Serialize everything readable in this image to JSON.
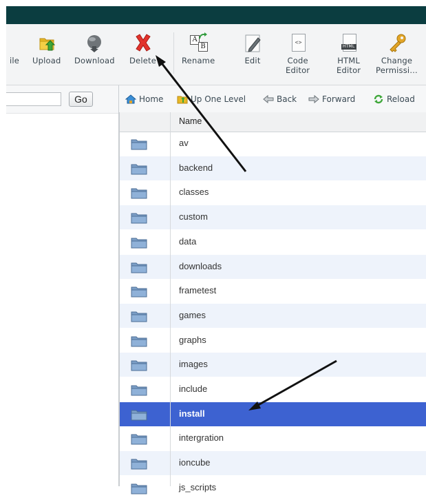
{
  "toolbar": {
    "file_partial": "ile",
    "upload": "Upload",
    "download": "Download",
    "delete": "Delete",
    "rename": "Rename",
    "edit": "Edit",
    "code_editor_1": "Code",
    "code_editor_2": "Editor",
    "html_editor_1": "HTML",
    "html_editor_2": "Editor",
    "change_perm_1": "Change",
    "change_perm_2": "Permissi…",
    "html_icon_text": "HTML",
    "rename_icon_a": "A",
    "rename_icon_b": "B",
    "code_icon_text": "<>"
  },
  "search": {
    "value": "",
    "go_label": "Go"
  },
  "nav": {
    "home": "Home",
    "up": "Up One Level",
    "back": "Back",
    "forward": "Forward",
    "reload": "Reload"
  },
  "table": {
    "header_name": "Name",
    "rows": [
      "av",
      "backend",
      "classes",
      "custom",
      "data",
      "downloads",
      "frametest",
      "games",
      "graphs",
      "images",
      "include",
      "install",
      "intergration",
      "ioncube",
      "js_scripts"
    ],
    "selected": "install"
  },
  "colors": {
    "accent": "#3d62d1",
    "topbar": "#0b3d40",
    "row_alt": "#eef3fb"
  }
}
